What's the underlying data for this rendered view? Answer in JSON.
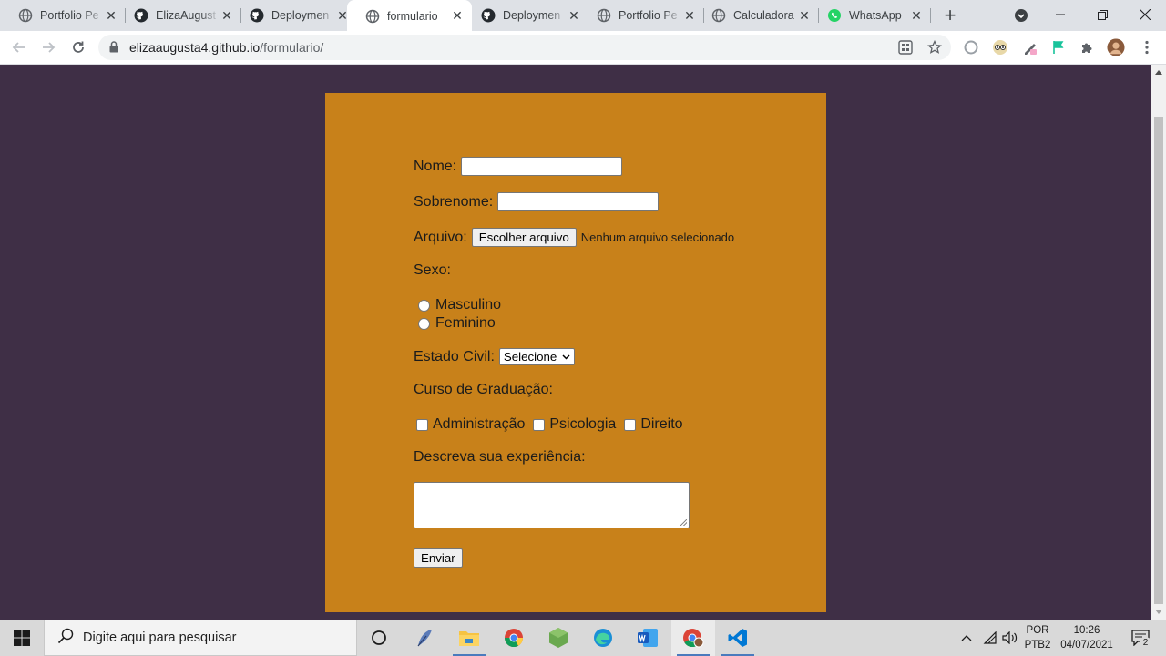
{
  "browser": {
    "tabs": [
      {
        "title": "Portfolio Pe",
        "icon": "globe-icon",
        "active": false
      },
      {
        "title": "ElizaAugust",
        "icon": "github-icon",
        "active": false
      },
      {
        "title": "Deploymen",
        "icon": "github-icon",
        "active": false
      },
      {
        "title": "formulario",
        "icon": "globe-icon",
        "active": true
      },
      {
        "title": "Deploymen",
        "icon": "github-icon",
        "active": false
      },
      {
        "title": "Portfolio Pe",
        "icon": "globe-icon",
        "active": false
      },
      {
        "title": "Calculadora",
        "icon": "globe-icon",
        "active": false
      },
      {
        "title": "WhatsApp",
        "icon": "whatsapp-icon",
        "active": false
      }
    ],
    "url_host": "elizaaugusta4.github.io",
    "url_path": "/formulario/"
  },
  "form": {
    "nome_label": "Nome:",
    "sobrenome_label": "Sobrenome:",
    "arquivo_label": "Arquivo:",
    "file_button": "Escolher arquivo",
    "file_status": "Nenhum arquivo selecionado",
    "sexo_label": "Sexo:",
    "sexo_options": [
      "Masculino",
      "Feminino"
    ],
    "estado_civil_label": "Estado Civil:",
    "estado_civil_selected": "Selecione",
    "curso_label": "Curso de Graduação:",
    "cursos": [
      "Administração",
      "Psicologia",
      "Direito"
    ],
    "experiencia_label": "Descreva sua experiência:",
    "submit": "Enviar"
  },
  "colors": {
    "page_bg": "#3f2f46",
    "form_bg": "#c8811a"
  },
  "taskbar": {
    "search_placeholder": "Digite aqui para pesquisar",
    "lang_top": "POR",
    "lang_bottom": "PTB2",
    "time": "10:26",
    "date": "04/07/2021",
    "notification_count": "2"
  }
}
